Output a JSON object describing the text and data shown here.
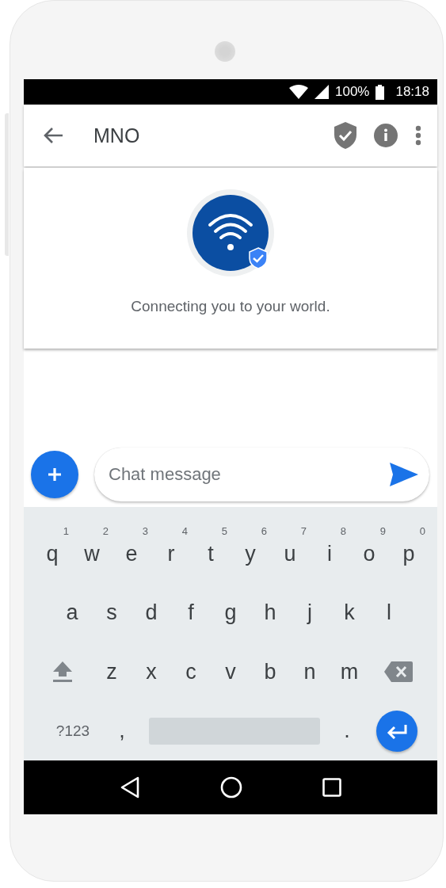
{
  "status_bar": {
    "battery": "100%",
    "time": "18:18"
  },
  "app_bar": {
    "title": "MNO"
  },
  "banner": {
    "tagline": "Connecting you to your world."
  },
  "composer": {
    "placeholder": "Chat message"
  },
  "keyboard": {
    "rows": [
      {
        "keys": [
          {
            "kind": "letter",
            "label": "q",
            "hint": "1"
          },
          {
            "kind": "letter",
            "label": "w",
            "hint": "2"
          },
          {
            "kind": "letter",
            "label": "e",
            "hint": "3"
          },
          {
            "kind": "letter",
            "label": "r",
            "hint": "4"
          },
          {
            "kind": "letter",
            "label": "t",
            "hint": "5"
          },
          {
            "kind": "letter",
            "label": "y",
            "hint": "6"
          },
          {
            "kind": "letter",
            "label": "u",
            "hint": "7"
          },
          {
            "kind": "letter",
            "label": "i",
            "hint": "8"
          },
          {
            "kind": "letter",
            "label": "o",
            "hint": "9"
          },
          {
            "kind": "letter",
            "label": "p",
            "hint": "0"
          }
        ]
      },
      {
        "keys": [
          {
            "kind": "letter",
            "label": "a"
          },
          {
            "kind": "letter",
            "label": "s"
          },
          {
            "kind": "letter",
            "label": "d"
          },
          {
            "kind": "letter",
            "label": "f"
          },
          {
            "kind": "letter",
            "label": "g"
          },
          {
            "kind": "letter",
            "label": "h"
          },
          {
            "kind": "letter",
            "label": "j"
          },
          {
            "kind": "letter",
            "label": "k"
          },
          {
            "kind": "letter",
            "label": "l"
          }
        ]
      },
      {
        "keys": [
          {
            "kind": "shift"
          },
          {
            "kind": "letter",
            "label": "z"
          },
          {
            "kind": "letter",
            "label": "x"
          },
          {
            "kind": "letter",
            "label": "c"
          },
          {
            "kind": "letter",
            "label": "v"
          },
          {
            "kind": "letter",
            "label": "b"
          },
          {
            "kind": "letter",
            "label": "n"
          },
          {
            "kind": "letter",
            "label": "m"
          },
          {
            "kind": "backspace"
          }
        ]
      },
      {
        "keys": [
          {
            "kind": "mode",
            "label": "?123"
          },
          {
            "kind": "letter",
            "label": ","
          },
          {
            "kind": "space"
          },
          {
            "kind": "letter",
            "label": "."
          },
          {
            "kind": "enter"
          }
        ]
      }
    ]
  }
}
